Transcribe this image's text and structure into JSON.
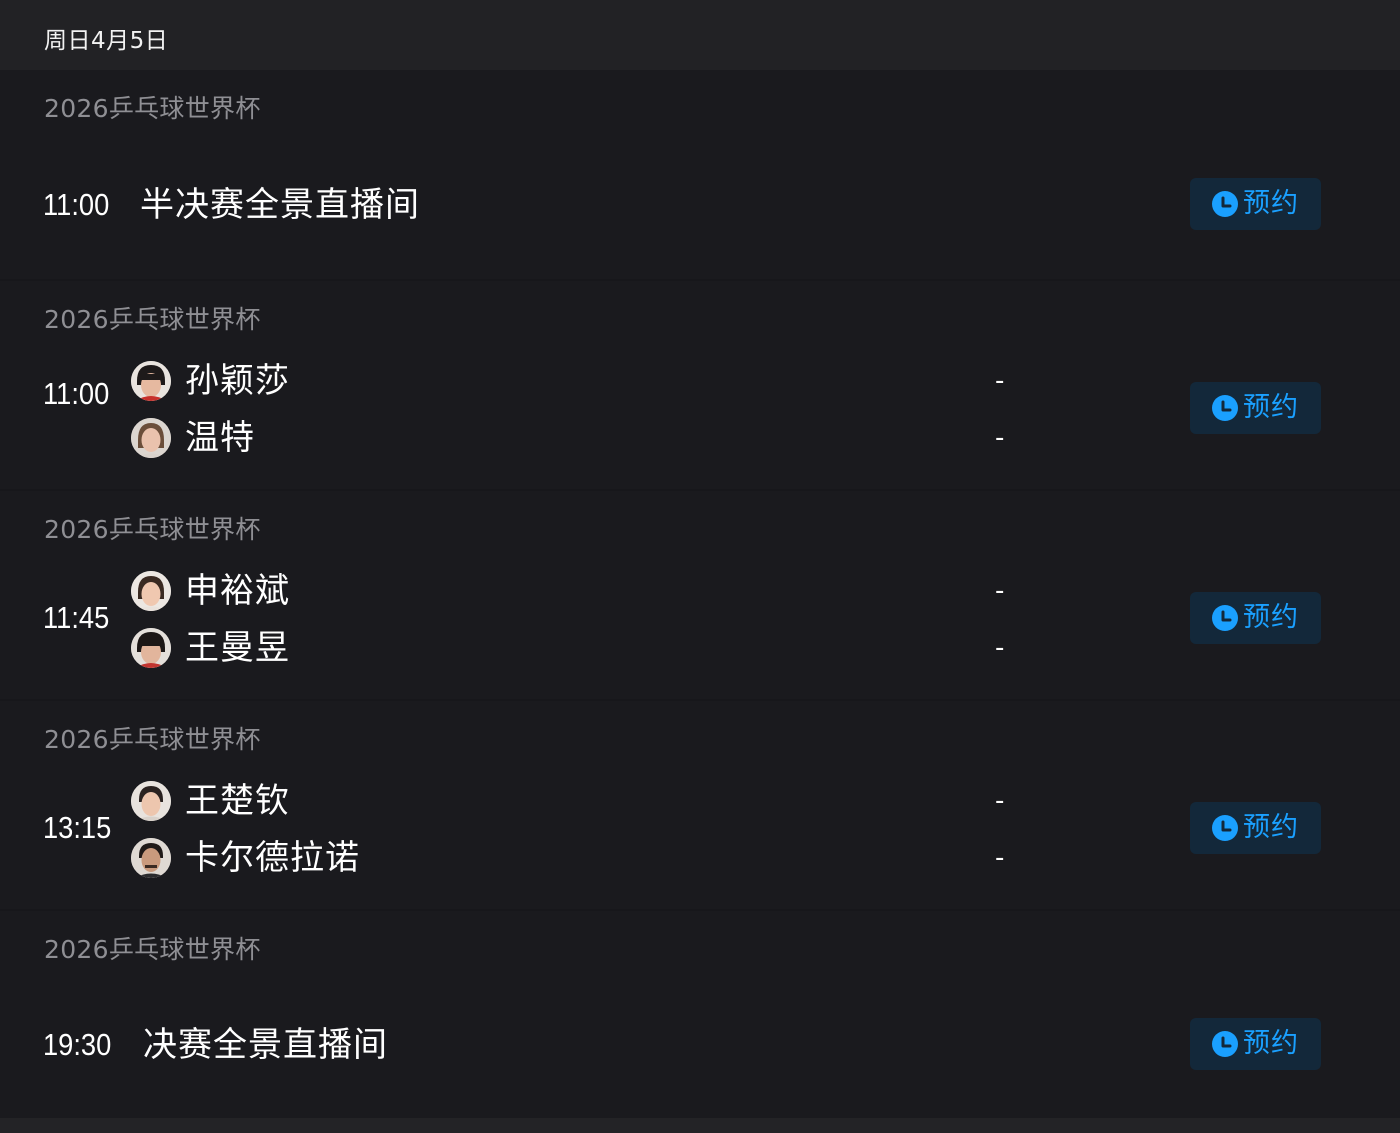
{
  "header": {
    "date": "周日4月5日"
  },
  "colors": {
    "background": "#17171b",
    "card": "#1a1a1e",
    "accent": "#1aa0ff",
    "button_bg": "#13283a",
    "league_text": "#8f8f94"
  },
  "matches": [
    {
      "league": "2026乒乓球世界杯",
      "time": "11:00",
      "title": "半决赛全景直播间",
      "reserve_label": "预约",
      "reserve_icon": "clock-icon"
    },
    {
      "league": "2026乒乓球世界杯",
      "time": "11:00",
      "players": [
        {
          "name": "孙颖莎",
          "score": "-",
          "avatar": "player-avatar"
        },
        {
          "name": "温特",
          "score": "-",
          "avatar": "player-avatar"
        }
      ],
      "reserve_label": "预约",
      "reserve_icon": "clock-icon"
    },
    {
      "league": "2026乒乓球世界杯",
      "time": "11:45",
      "players": [
        {
          "name": "申裕斌",
          "score": "-",
          "avatar": "player-avatar"
        },
        {
          "name": "王曼昱",
          "score": "-",
          "avatar": "player-avatar"
        }
      ],
      "reserve_label": "预约",
      "reserve_icon": "clock-icon"
    },
    {
      "league": "2026乒乓球世界杯",
      "time": "13:15",
      "players": [
        {
          "name": "王楚钦",
          "score": "-",
          "avatar": "player-avatar"
        },
        {
          "name": "卡尔德拉诺",
          "score": "-",
          "avatar": "player-avatar"
        }
      ],
      "reserve_label": "预约",
      "reserve_icon": "clock-icon"
    },
    {
      "league": "2026乒乓球世界杯",
      "time": "19:30",
      "title": "决赛全景直播间",
      "reserve_label": "预约",
      "reserve_icon": "clock-icon"
    }
  ]
}
